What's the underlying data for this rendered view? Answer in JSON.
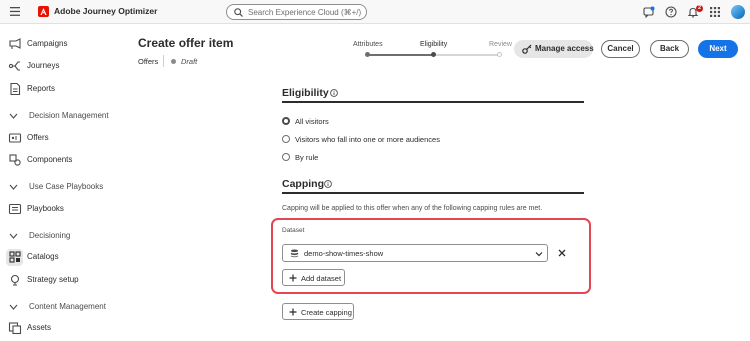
{
  "app": {
    "title": "Adobe Journey Optimizer",
    "search_placeholder": "Search Experience Cloud (⌘+/)",
    "notification_count": "2",
    "brand_color": "#eb1000",
    "accent_color": "#1473e6"
  },
  "sidebar": {
    "items": [
      {
        "label": "Campaigns",
        "icon": "campaigns-icon"
      },
      {
        "label": "Journeys",
        "icon": "journeys-icon"
      },
      {
        "label": "Reports",
        "icon": "reports-icon"
      }
    ],
    "sections": [
      {
        "label": "Decision Management",
        "items": [
          {
            "label": "Offers",
            "icon": "offers-icon"
          },
          {
            "label": "Components",
            "icon": "components-icon"
          }
        ]
      },
      {
        "label": "Use Case Playbooks",
        "items": [
          {
            "label": "Playbooks",
            "icon": "playbooks-icon"
          }
        ]
      },
      {
        "label": "Decisioning",
        "items": [
          {
            "label": "Catalogs",
            "icon": "catalogs-icon",
            "active": true
          },
          {
            "label": "Strategy setup",
            "icon": "strategy-icon"
          }
        ]
      },
      {
        "label": "Content Management",
        "items": [
          {
            "label": "Assets",
            "icon": "assets-icon"
          }
        ]
      }
    ]
  },
  "header": {
    "title": "Create offer item",
    "breadcrumb": "Offers",
    "status": "Draft",
    "steps": [
      "Attributes",
      "Eligibility",
      "Review"
    ],
    "current_step": "Eligibility",
    "buttons": {
      "manage_access": "Manage access",
      "cancel": "Cancel",
      "back": "Back",
      "next": "Next"
    }
  },
  "eligibility": {
    "title": "Eligibility",
    "options": [
      "All visitors",
      "Visitors who fall into one or more audiences",
      "By rule"
    ],
    "selected": "All visitors"
  },
  "capping": {
    "title": "Capping",
    "help": "Capping will be applied to this offer when any of the following capping rules are met.",
    "dataset_label": "Dataset",
    "dataset_value": "demo-show-times-show",
    "add_dataset": "Add dataset",
    "create_capping": "Create capping"
  }
}
